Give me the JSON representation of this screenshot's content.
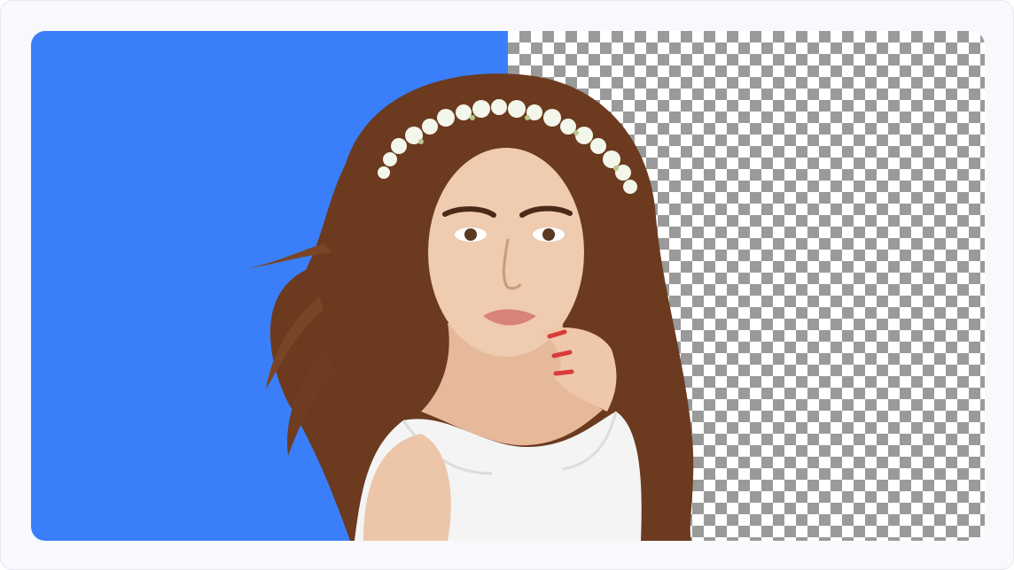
{
  "colors": {
    "replacement_background": "#3a7ff9",
    "checker_dark": "#9a9a9a",
    "checker_light": "#ffffff",
    "hair": "#6b3a1f",
    "skin": "#e9c0a4",
    "dress": "#f4f4f4",
    "flowers": "#f3f6ea"
  },
  "subject": {
    "description_icon": "portrait-cutout"
  }
}
